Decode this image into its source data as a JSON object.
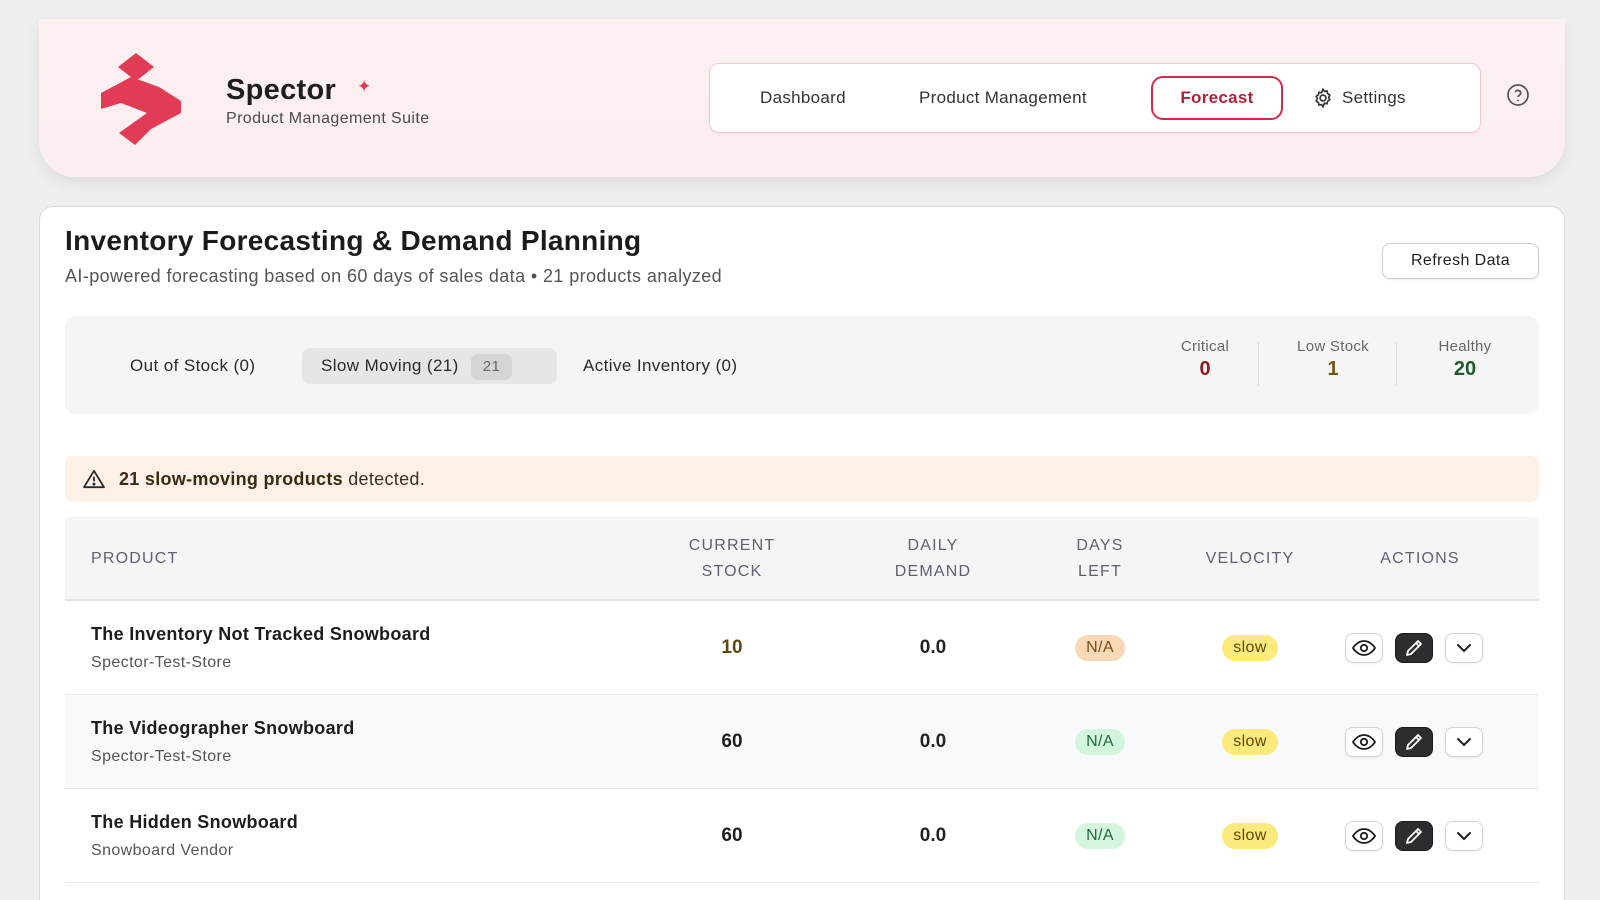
{
  "brand": {
    "name": "Spector",
    "spark": "✦",
    "subtitle": "Product Management Suite",
    "accent": "#e23b55"
  },
  "nav": {
    "dashboard": "Dashboard",
    "product_management": "Product Management",
    "forecast": "Forecast",
    "settings": "Settings",
    "active": "Forecast"
  },
  "page": {
    "title": "Inventory Forecasting & Demand Planning",
    "subtitle": "AI-powered forecasting based on 60 days of sales data • 21 products analyzed",
    "refresh_label": "Refresh Data"
  },
  "tabs": {
    "out_of_stock": "Out of Stock (0)",
    "slow_moving": "Slow Moving (21)",
    "slow_moving_count": "21",
    "active_inventory": "Active Inventory (0)",
    "selected": "Slow Moving (21)"
  },
  "stats": {
    "critical": {
      "label": "Critical",
      "value": "0",
      "color": "#8f1d1d"
    },
    "low_stock": {
      "label": "Low Stock",
      "value": "1",
      "color": "#6b5a10"
    },
    "healthy": {
      "label": "Healthy",
      "value": "20",
      "color": "#1f5a2c"
    }
  },
  "alert": {
    "icon": "warning-triangle-icon",
    "bold": "21 slow-moving products",
    "rest": " detected."
  },
  "table": {
    "headers": {
      "product": "PRODUCT",
      "current_stock_1": "CURRENT",
      "current_stock_2": "STOCK",
      "daily_demand_1": "DAILY",
      "daily_demand_2": "DEMAND",
      "days_left_1": "DAYS",
      "days_left_2": "LEFT",
      "velocity": "VELOCITY",
      "actions": "ACTIONS"
    },
    "rows": [
      {
        "name": "The Inventory Not Tracked Snowboard",
        "vendor": "Spector-Test-Store",
        "stock": "10",
        "stock_color": "#5a4a0d",
        "demand": "0.0",
        "days_left": "N/A",
        "days_status": "warn",
        "velocity": "slow"
      },
      {
        "name": "The Videographer Snowboard",
        "vendor": "Spector-Test-Store",
        "stock": "60",
        "stock_color": "#1d1d1d",
        "demand": "0.0",
        "days_left": "N/A",
        "days_status": "ok",
        "velocity": "slow"
      },
      {
        "name": "The Hidden Snowboard",
        "vendor": "Snowboard Vendor",
        "stock": "60",
        "stock_color": "#1d1d1d",
        "demand": "0.0",
        "days_left": "N/A",
        "days_status": "ok",
        "velocity": "slow"
      }
    ]
  }
}
